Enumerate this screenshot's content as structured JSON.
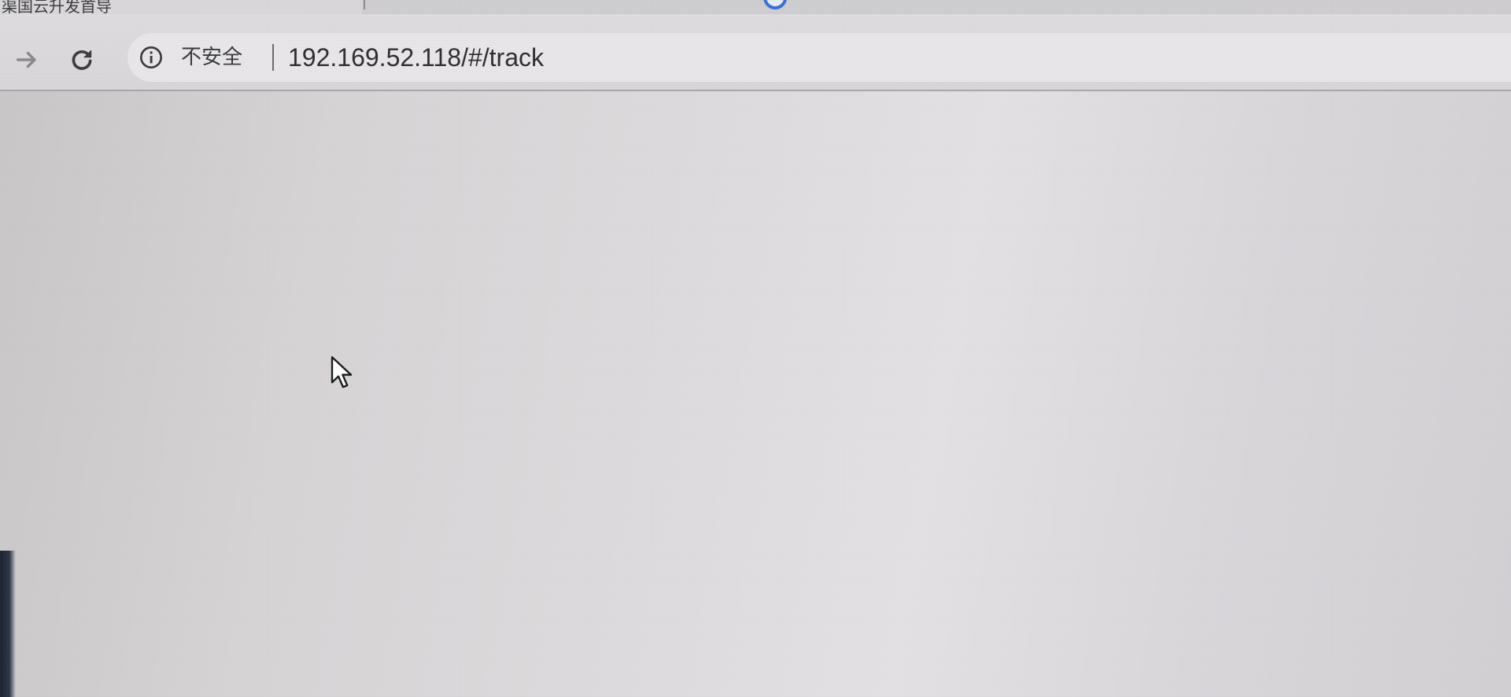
{
  "browser": {
    "tab": {
      "title": "渠国云升发首导"
    },
    "toolbar": {
      "forward_icon": "arrow-right-icon",
      "reload_icon": "reload-icon"
    },
    "omnibox": {
      "security_icon": "info-icon",
      "security_label": "不安全",
      "url": "192.169.52.118/#/track"
    }
  },
  "page": {
    "content": ""
  },
  "colors": {
    "accent": "#3b6fd8",
    "page_background": "#dddbdd",
    "toolbar_background": "#dad8db"
  }
}
